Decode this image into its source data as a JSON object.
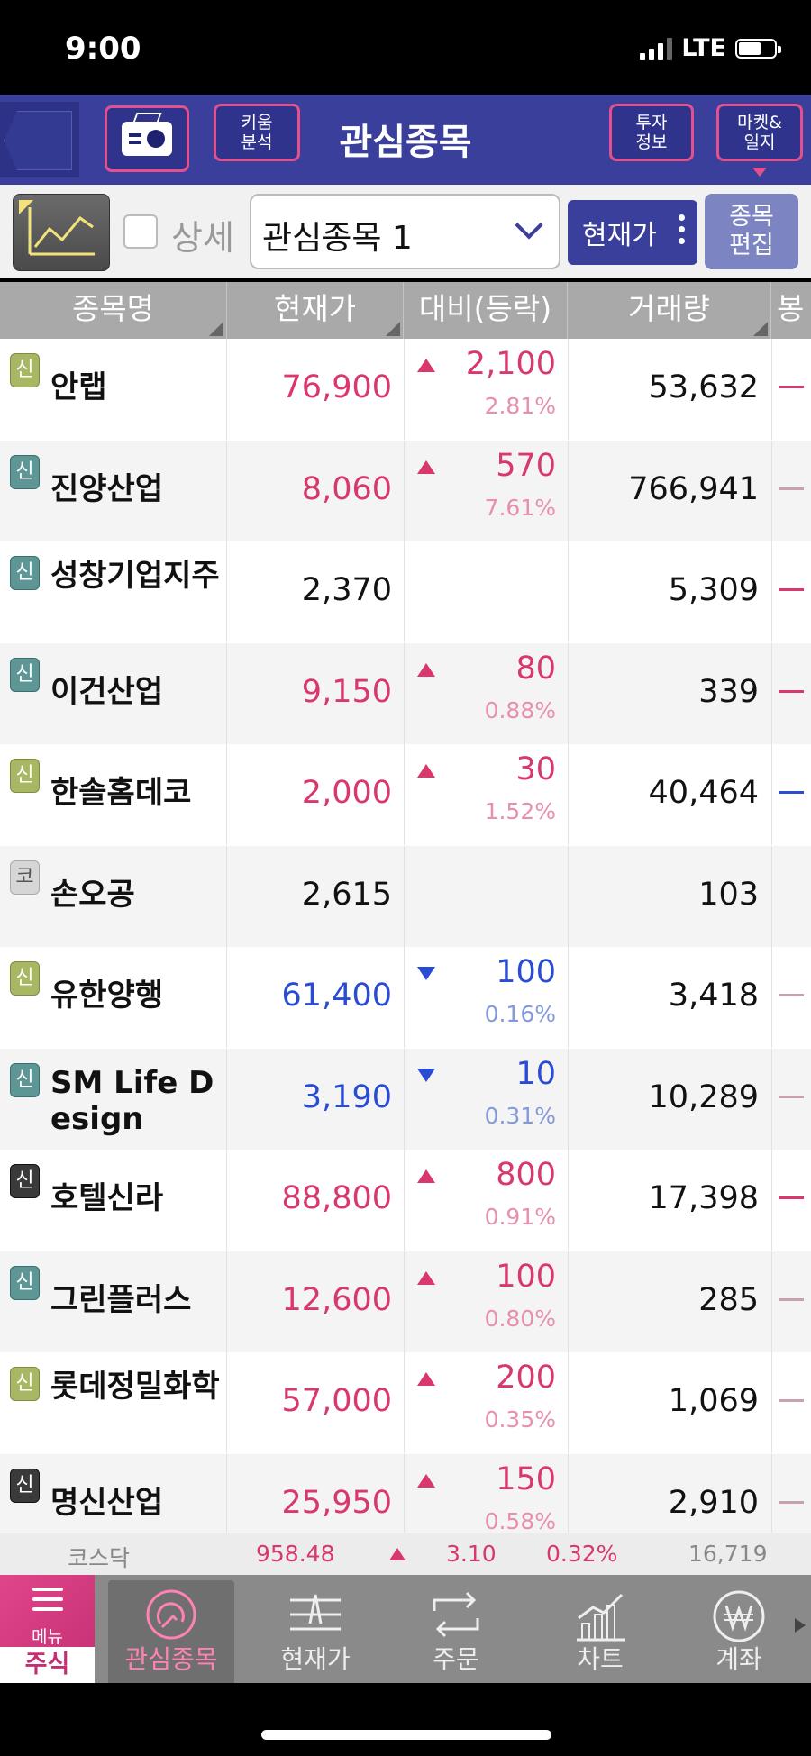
{
  "status": {
    "time": "9:00",
    "network": "LTE"
  },
  "header": {
    "title": "관심종목",
    "kiwoom_label": "키움\n분석",
    "invest_label": "투자\n정보",
    "market_label": "마켓&\n일지"
  },
  "toolbar": {
    "detail_label": "상세",
    "group_select": "관심종목 1",
    "price_button": "현재가",
    "edit_button": "종목\n편집"
  },
  "columns": [
    "종목명",
    "현재가",
    "대비(등락)",
    "거래량",
    "봉"
  ],
  "colors": {
    "up": "#d8386b",
    "down": "#2a4bd4",
    "accent": "#3b3f9c",
    "menu": "#c42f73"
  },
  "stocks": [
    {
      "badge": "신",
      "badge_color": "g",
      "name": "안랩",
      "price": "76,900",
      "dir": "up",
      "change": "2,100",
      "pct": "2.81%",
      "volume": "53,632",
      "mini": "#d8386b"
    },
    {
      "badge": "신",
      "badge_color": "t",
      "name": "진양산업",
      "price": "8,060",
      "dir": "up",
      "change": "570",
      "pct": "7.61%",
      "volume": "766,941",
      "mini": "#c9a0ae"
    },
    {
      "badge": "신",
      "badge_color": "t",
      "name": "성창기업지주",
      "price": "2,370",
      "dir": "none",
      "change": "",
      "pct": "",
      "volume": "5,309",
      "mini": "#d8386b"
    },
    {
      "badge": "신",
      "badge_color": "t",
      "name": "이건산업",
      "price": "9,150",
      "dir": "up",
      "change": "80",
      "pct": "0.88%",
      "volume": "339",
      "mini": "#d8386b"
    },
    {
      "badge": "신",
      "badge_color": "g",
      "name": "한솔홈데코",
      "price": "2,000",
      "dir": "up",
      "change": "30",
      "pct": "1.52%",
      "volume": "40,464",
      "mini": "#2a4bd4"
    },
    {
      "badge": "코",
      "badge_color": "w",
      "name": "손오공",
      "price": "2,615",
      "dir": "none",
      "change": "",
      "pct": "",
      "volume": "103",
      "mini": ""
    },
    {
      "badge": "신",
      "badge_color": "g",
      "name": "유한양행",
      "price": "61,400",
      "dir": "down",
      "change": "100",
      "pct": "0.16%",
      "volume": "3,418",
      "mini": "#c9a0ae"
    },
    {
      "badge": "신",
      "badge_color": "t",
      "name": "SM Life Design",
      "price": "3,190",
      "dir": "down",
      "change": "10",
      "pct": "0.31%",
      "volume": "10,289",
      "mini": "#c9a0ae"
    },
    {
      "badge": "신",
      "badge_color": "k",
      "name": "호텔신라",
      "price": "88,800",
      "dir": "up",
      "change": "800",
      "pct": "0.91%",
      "volume": "17,398",
      "mini": "#d8386b"
    },
    {
      "badge": "신",
      "badge_color": "t",
      "name": "그린플러스",
      "price": "12,600",
      "dir": "up",
      "change": "100",
      "pct": "0.80%",
      "volume": "285",
      "mini": "#c9a0ae"
    },
    {
      "badge": "신",
      "badge_color": "g",
      "name": "롯데정밀화학",
      "price": "57,000",
      "dir": "up",
      "change": "200",
      "pct": "0.35%",
      "volume": "1,069",
      "mini": "#c9a0ae"
    },
    {
      "badge": "신",
      "badge_color": "k",
      "name": "명신산업",
      "price": "25,950",
      "dir": "up",
      "change": "150",
      "pct": "0.58%",
      "volume": "2,910",
      "mini": "#c9a0ae"
    }
  ],
  "index_bar": {
    "name": "코스닥",
    "value": "958.48",
    "change": "3.10",
    "pct": "0.32%",
    "volume": "16,719"
  },
  "nav": {
    "menu_label": "메뉴",
    "stock_label": "주식",
    "tabs": [
      "관심종목",
      "현재가",
      "주문",
      "차트",
      "계좌"
    ]
  }
}
